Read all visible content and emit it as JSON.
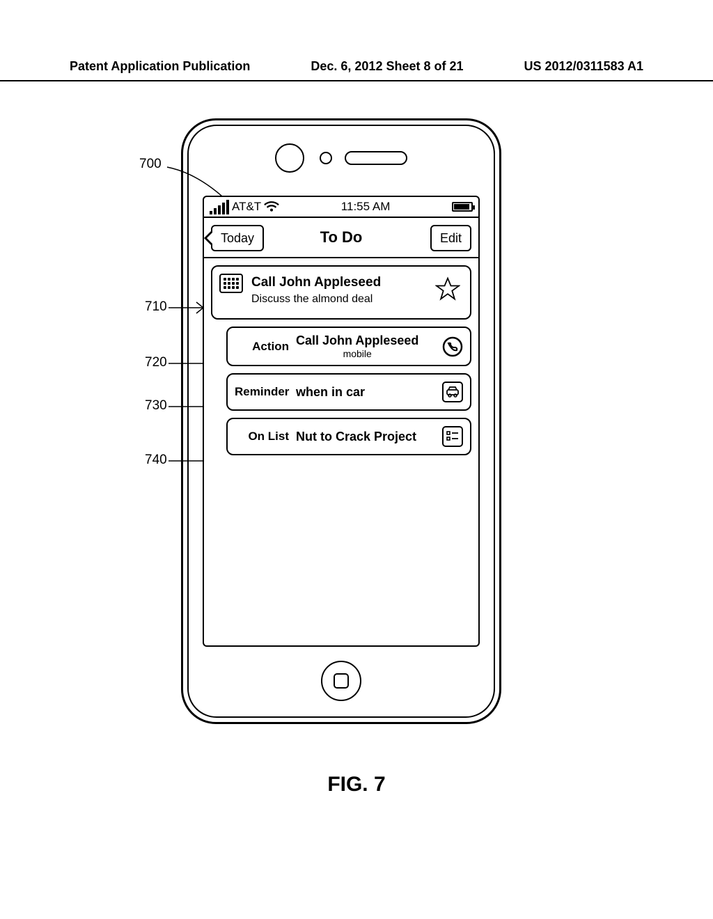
{
  "header": {
    "left": "Patent Application Publication",
    "mid": "Dec. 6, 2012  Sheet 8 of 21",
    "right": "US 2012/0311583 A1"
  },
  "status": {
    "carrier": "AT&T",
    "time": "11:55 AM"
  },
  "nav": {
    "left": "Today",
    "title": "To Do",
    "right": "Edit"
  },
  "main_item": {
    "title": "Call John Appleseed",
    "subtitle": "Discuss the almond deal"
  },
  "rows": {
    "action": {
      "label": "Action",
      "value": "Call John Appleseed",
      "sub": "mobile"
    },
    "reminder": {
      "label": "Reminder",
      "value": "when in car"
    },
    "onlist": {
      "label": "On List",
      "value": "Nut to Crack Project"
    }
  },
  "callouts": {
    "c700": "700",
    "c710": "710",
    "c720": "720",
    "c730": "730",
    "c740": "740"
  },
  "figure": "FIG. 7"
}
